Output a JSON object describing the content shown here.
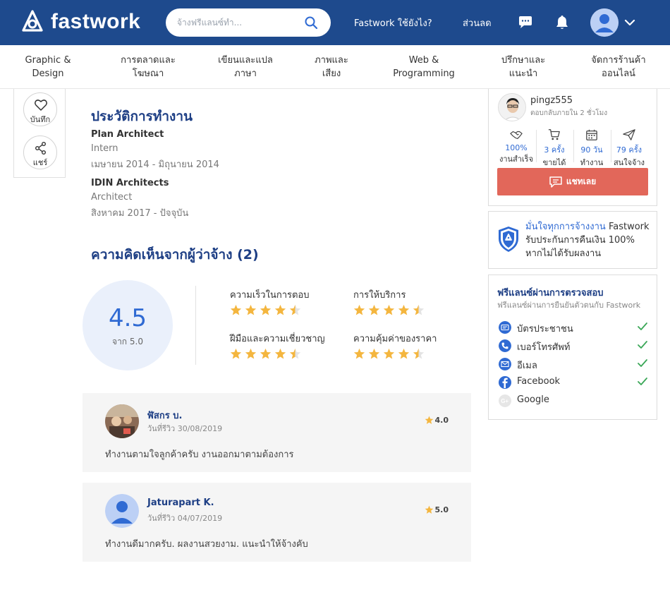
{
  "header": {
    "logo_text": "fastwork",
    "search_placeholder": "จ้างฟรีแลนซ์ทำ...",
    "how_link": "Fastwork ใช้ยังไง?",
    "discount_link": "ส่วนลด"
  },
  "categories": [
    {
      "line1": "Graphic &",
      "line2": "Design"
    },
    {
      "line1": "การตลาดและ",
      "line2": "โฆษณา"
    },
    {
      "line1": "เขียนและแปล",
      "line2": "ภาษา"
    },
    {
      "line1": "ภาพและ",
      "line2": "เสียง"
    },
    {
      "line1": "Web &",
      "line2": "Programming"
    },
    {
      "line1": "ปรึกษาและ",
      "line2": "แนะนำ"
    },
    {
      "line1": "จัดการร้านค้า",
      "line2": "ออนไลน์"
    }
  ],
  "side_actions": {
    "save_label": "บันทึก",
    "share_label": "แชร์"
  },
  "work_history": {
    "heading": "ประวัติการทำงาน",
    "jobs": [
      {
        "company": "Plan Architect",
        "role": "Intern",
        "period": "เมษายน 2014 - มิถุนายน 2014"
      },
      {
        "company": "IDIN Architects",
        "role": "Architect",
        "period": "สิงหาคม 2017 - ปัจจุบัน"
      }
    ]
  },
  "reviews_section": {
    "heading": "ความคิดเห็นจากผู้ว่าจ้าง (2)",
    "average": "4.5",
    "out_of": "จาก 5.0",
    "criteria": [
      {
        "label": "ความเร็วในการตอบ",
        "stars": 4.5
      },
      {
        "label": "การให้บริการ",
        "stars": 4.5
      },
      {
        "label": "ฝีมือและความเชี่ยวชาญ",
        "stars": 4.5
      },
      {
        "label": "ความคุ้มค่าของราคา",
        "stars": 4.5
      }
    ],
    "reviews": [
      {
        "name": "ฬัสกร บ.",
        "date": "วันที่รีวิว 30/08/2019",
        "score": "4.0",
        "text": "ทำงานตามใจลูกค้าครับ งานออกมาตามต้องการ"
      },
      {
        "name": "Jaturapart K.",
        "date": "วันที่รีวิว 04/07/2019",
        "score": "5.0",
        "text": "ทำงานดีมากครับ. ผลงานสวยงาม. แนะนำให้จ้างคับ"
      }
    ]
  },
  "seller": {
    "username": "pingz555",
    "response": "ตอบกลับภายใน 2 ชั่วโมง",
    "stats": [
      {
        "icon": "handshake-icon",
        "value": "100%",
        "label": "งานสำเร็จ"
      },
      {
        "icon": "cart-icon",
        "value": "3 ครั้ง",
        "label": "ขายได้"
      },
      {
        "icon": "calendar-icon",
        "value": "90 วัน",
        "label": "ทำงาน"
      },
      {
        "icon": "send-icon",
        "value": "79 ครั้ง",
        "label": "สนใจจ้าง"
      }
    ],
    "chat_button": "แชทเลย"
  },
  "guarantee": {
    "line1_blue": "มั่นใจทุกการจ้างงาน",
    "line1_rest": " Fastwork",
    "line2": "รับประกันการคืนเงิน 100%",
    "line3": "หากไม่ได้รับผลงาน"
  },
  "verification": {
    "title": "ฟรีแลนซ์ผ่านการตรวจสอบ",
    "subtitle": "ฟรีแลนซ์ผ่านการยืนยันตัวตนกับ Fastwork",
    "items": [
      {
        "label": "บัตรประชาชน",
        "verified": true
      },
      {
        "label": "เบอร์โทรศัพท์",
        "verified": true
      },
      {
        "label": "อีเมล",
        "verified": true
      },
      {
        "label": "Facebook",
        "verified": true
      },
      {
        "label": "Google",
        "verified": false
      }
    ]
  },
  "colors": {
    "brand": "#1e4a8d",
    "accent_blue": "#2f6ad3",
    "chat_button": "#e2675a",
    "star": "#f4b63f",
    "check": "#3aa757"
  }
}
